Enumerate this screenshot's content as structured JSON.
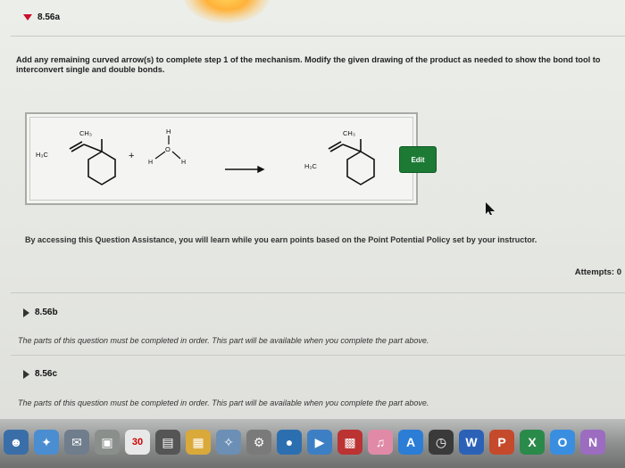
{
  "part_a": {
    "label": "8.56a",
    "instructions": "Add any remaining curved arrow(s) to complete step 1 of the mechanism. Modify the given drawing of the product as needed to show the bond tool to interconvert single and double bonds.",
    "edit_label": "Edit",
    "assistance_text": "By accessing this Question Assistance, you will learn while you earn points based on the Point Potential Policy set by your instructor.",
    "attempts": "Attempts: 0"
  },
  "molecule": {
    "ch3_left": "CH₃",
    "h3c_left": "H₃C",
    "plus": "+",
    "water_h_top": "H",
    "water_h_left": "H",
    "water_h_right": "H",
    "water_o": "O",
    "ch3_right": "CH₃",
    "h3c_right": "H₃C"
  },
  "part_b": {
    "label": "8.56b",
    "note": "The parts of this question must be completed in order. This part will be available when you complete the part above."
  },
  "part_c": {
    "label": "8.56c",
    "note": "The parts of this question must be completed in order. This part will be available when you complete the part above."
  },
  "dock": {
    "calendar_day": "30"
  }
}
